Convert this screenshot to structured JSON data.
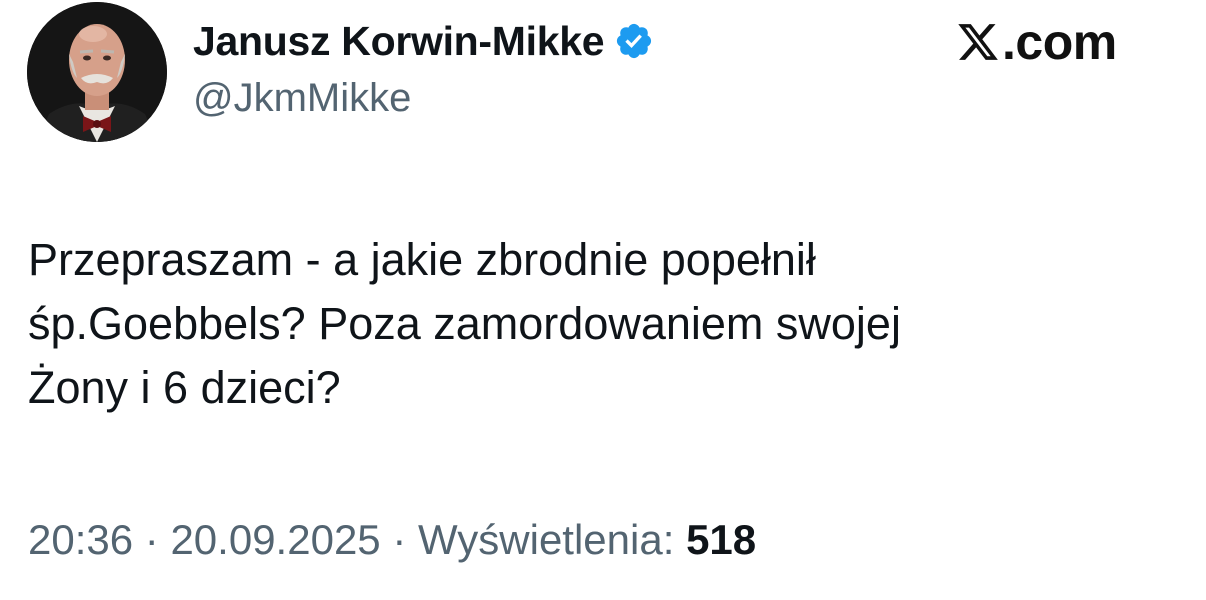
{
  "author": {
    "display_name": "Janusz Korwin-Mikke",
    "handle": "@JkmMikke",
    "verified": true,
    "avatar_icon": "profile-photo",
    "badge_icon": "verified-check-icon",
    "badge_color": "#1d9bf0"
  },
  "site": {
    "logo_icon": "x-logo-icon",
    "domain": ".com"
  },
  "tweet": {
    "lines": [
      "Przepraszam - a jakie zbrodnie popełnił",
      "śp.Goebbels? Poza zamordowaniem swojej",
      "Żony i 6 dzieci?"
    ]
  },
  "meta": {
    "time": "20:36",
    "separator": "·",
    "date": "20.09.2025",
    "views_label": "Wyświetlenia:",
    "views_count": "518"
  },
  "colors": {
    "text_primary": "#0f1419",
    "text_secondary": "#536471",
    "accent": "#1d9bf0"
  }
}
